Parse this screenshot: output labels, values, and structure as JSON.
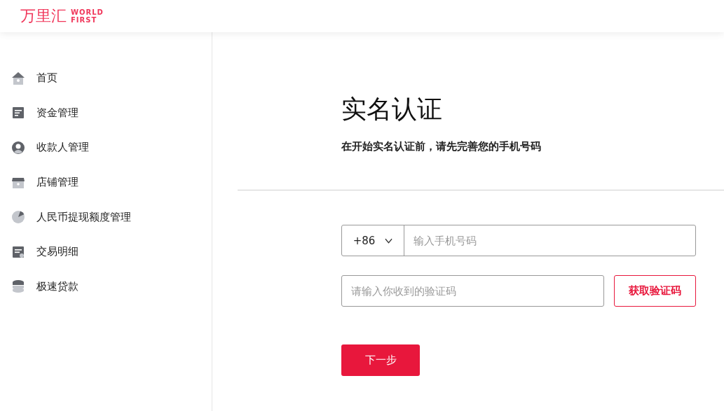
{
  "header": {
    "logo_cn": "万里汇",
    "logo_en_1": "WORLD",
    "logo_en_2": "FIRST"
  },
  "sidebar": {
    "items": [
      {
        "label": "首页"
      },
      {
        "label": "资金管理"
      },
      {
        "label": "收款人管理"
      },
      {
        "label": "店铺管理"
      },
      {
        "label": "人民币提现额度管理"
      },
      {
        "label": "交易明细"
      },
      {
        "label": "极速贷款"
      }
    ]
  },
  "main": {
    "title": "实名认证",
    "subtitle": "在开始实名认证前，请先完善您的手机号码",
    "country_code": "+86",
    "phone": {
      "placeholder": "输入手机号码"
    },
    "code": {
      "placeholder": "请输入你收到的验证码"
    },
    "get_code_button": "获取验证码",
    "next_button": "下一步"
  }
}
